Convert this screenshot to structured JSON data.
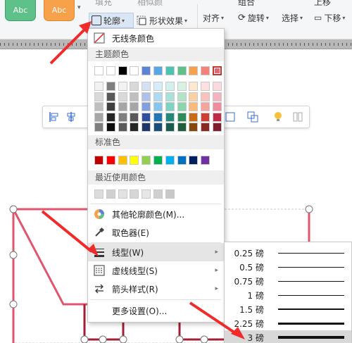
{
  "ribbon": {
    "style1_label": "Abc",
    "style2_label": "Abc",
    "fill_label": "填充",
    "text_fill_label": "相似颜",
    "outline_label": "轮廓",
    "shape_effect_label": "形状效果",
    "align_label": "对齐",
    "group_label": "组合",
    "rotate_label": "旋转",
    "select_label": "选择",
    "up_label": "上移",
    "down_label": "下移"
  },
  "dropdown": {
    "no_line_label": "无线条颜色",
    "theme_colors_label": "主题颜色",
    "standard_colors_label": "标准色",
    "recent_colors_label": "最近使用颜色",
    "more_colors_label": "其他轮廓颜色(M)...",
    "eyedropper_label": "取色器(E)",
    "line_style_label": "线型(W)",
    "dash_style_label": "虚线线型(S)",
    "arrow_style_label": "箭头样式(R)",
    "more_settings_label": "更多设置(O)...",
    "theme_row": [
      "#ffffff",
      "#ffffff",
      "#000000",
      "#ffffff",
      "#5b83d6",
      "#56a7e3",
      "#4bc3b0",
      "#5fc18a",
      "#f7a24a",
      "#f2837a",
      "#e8627a"
    ],
    "theme_shades": [
      [
        "#f2f2f2",
        "#7f7f7f",
        "#f2f2f2",
        "#d9d9d9",
        "#d6e0f5",
        "#d7ecf9",
        "#d4f0ec",
        "#d8f1e3",
        "#fde8d2",
        "#fce1de",
        "#fad9df"
      ],
      [
        "#d9d9d9",
        "#595959",
        "#d9d9d9",
        "#bfbfbf",
        "#adc1eb",
        "#afd8f3",
        "#a9e1d8",
        "#b1e3c7",
        "#fbd0a5",
        "#f8c3bd",
        "#f5b3bf"
      ],
      [
        "#bfbfbf",
        "#3f3f3f",
        "#a6a6a6",
        "#a6a6a6",
        "#839fe0",
        "#86c5ee",
        "#7dd3c4",
        "#8bd5ac",
        "#f9b978",
        "#f5a49c",
        "#f08ca0"
      ],
      [
        "#a6a6a6",
        "#262626",
        "#7f7f7f",
        "#595959",
        "#2f4f9c",
        "#2477b6",
        "#23897a",
        "#2f8c58",
        "#c96b14",
        "#cd3f32",
        "#c02a47"
      ],
      [
        "#7f7f7f",
        "#0d0d0d",
        "#595959",
        "#262626",
        "#1f3468",
        "#184f79",
        "#175b51",
        "#1f5d3b",
        "#86470d",
        "#882a21",
        "#801c2f"
      ]
    ],
    "standard_row": [
      "#c00000",
      "#ff0000",
      "#ffc000",
      "#ffff00",
      "#92d050",
      "#00b050",
      "#00b0f0",
      "#0070c0",
      "#002060",
      "#7030a0"
    ],
    "recent_row": [
      "#dcdcdc",
      "#d0d0d0",
      "#e2e2e2",
      "#d6d6d6",
      "#e6e6e6",
      "#cfcfcf",
      "#c8c8c8"
    ]
  },
  "line_weights": [
    {
      "label": "0.25 磅",
      "weight": 0.25
    },
    {
      "label": "0.5 磅",
      "weight": 0.5
    },
    {
      "label": "0.75 磅",
      "weight": 0.75
    },
    {
      "label": "1 磅",
      "weight": 1
    },
    {
      "label": "1.5 磅",
      "weight": 1.5
    },
    {
      "label": "2.25 磅",
      "weight": 2.25
    },
    {
      "label": "3 磅",
      "weight": 3
    }
  ],
  "selected_weight": "3 磅",
  "colors": {
    "accent": "#e8627a",
    "annotation_red": "#f02b2b",
    "highlight": "#dbe6f4"
  }
}
